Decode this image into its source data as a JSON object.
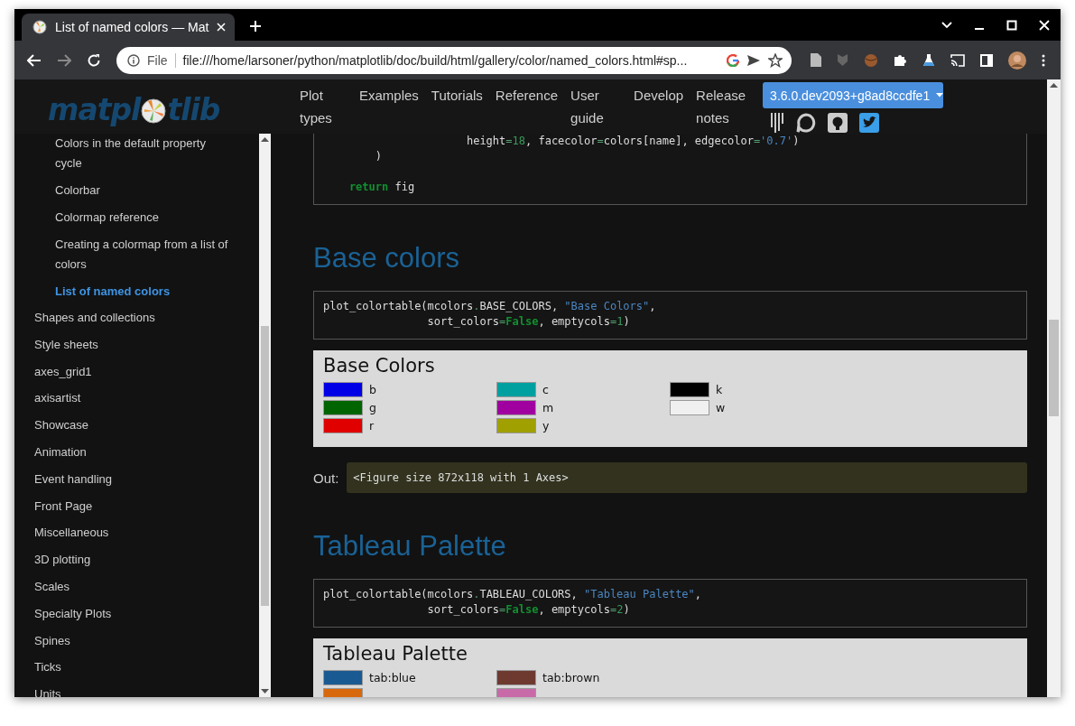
{
  "browser": {
    "tab": {
      "title": "List of named colors — Mat"
    },
    "address": {
      "scheme": "File",
      "url": "file:///home/larsoner/python/matplotlib/doc/build/html/gallery/color/named_colors.html#sp..."
    }
  },
  "header": {
    "logo": {
      "before": "matpl",
      "after": "tlib"
    },
    "nav": [
      {
        "label": "Plot types"
      },
      {
        "label": "Examples"
      },
      {
        "label": "Tutorials"
      },
      {
        "label": "Reference"
      },
      {
        "label": "User guide"
      },
      {
        "label": "Develop"
      },
      {
        "label": "Release notes"
      }
    ],
    "version_button": {
      "label": "3.6.0.dev2093+g8ad8ccdfe1"
    }
  },
  "sidebar": {
    "section_items": [
      {
        "label": "Colors in the default property cycle",
        "selected": false
      },
      {
        "label": "Colorbar",
        "selected": false
      },
      {
        "label": "Colormap reference",
        "selected": false
      },
      {
        "label": "Creating a colormap from a list of colors",
        "selected": false
      },
      {
        "label": "List of named colors",
        "selected": true
      }
    ],
    "items": [
      {
        "label": "Shapes and collections"
      },
      {
        "label": "Style sheets"
      },
      {
        "label": "axes_grid1"
      },
      {
        "label": "axisartist"
      },
      {
        "label": "Showcase"
      },
      {
        "label": "Animation"
      },
      {
        "label": "Event handling"
      },
      {
        "label": "Front Page"
      },
      {
        "label": "Miscellaneous"
      },
      {
        "label": "3D plotting"
      },
      {
        "label": "Scales"
      },
      {
        "label": "Specialty Plots"
      },
      {
        "label": "Spines"
      },
      {
        "label": "Ticks"
      },
      {
        "label": "Units"
      }
    ]
  },
  "content": [
    {
      "kind": "code",
      "cut_top": true,
      "lines": [
        {
          "kind": "code",
          "tokens": [
            {
              "kind": "text",
              "text": "                      height"
            },
            {
              "kind": "op",
              "text": "="
            },
            {
              "kind": "num",
              "text": "18"
            },
            {
              "kind": "text",
              "text": ", facecolor"
            },
            {
              "kind": "op",
              "text": "="
            },
            {
              "kind": "text",
              "text": "colors[name], edgecolor"
            },
            {
              "kind": "op",
              "text": "="
            },
            {
              "kind": "str",
              "text": "'0.7'"
            },
            {
              "kind": "text",
              "text": ")"
            }
          ]
        },
        {
          "kind": "code",
          "tokens": [
            {
              "kind": "text",
              "text": "        )"
            }
          ]
        },
        {
          "kind": "blank"
        },
        {
          "kind": "code",
          "tokens": [
            {
              "kind": "kw",
              "text": "    return"
            },
            {
              "kind": "text",
              "text": " fig"
            }
          ]
        }
      ]
    },
    {
      "kind": "heading",
      "text": "Base colors"
    },
    {
      "kind": "code",
      "cut_top": false,
      "lines": [
        {
          "kind": "code",
          "tokens": [
            {
              "kind": "text",
              "text": "plot_colortable(mcolors"
            },
            {
              "kind": "op",
              "text": "."
            },
            {
              "kind": "text",
              "text": "BASE_COLORS, "
            },
            {
              "kind": "str",
              "text": "\"Base Colors\""
            },
            {
              "kind": "text",
              "text": ","
            }
          ]
        },
        {
          "kind": "code",
          "tokens": [
            {
              "kind": "text",
              "text": "                sort_colors"
            },
            {
              "kind": "op",
              "text": "="
            },
            {
              "kind": "kw",
              "text": "False"
            },
            {
              "kind": "text",
              "text": ", emptycols"
            },
            {
              "kind": "op",
              "text": "="
            },
            {
              "kind": "num",
              "text": "1"
            },
            {
              "kind": "text",
              "text": ")"
            }
          ]
        }
      ]
    },
    {
      "kind": "figure",
      "title": "Base Colors",
      "columns": [
        [
          {
            "name": "b",
            "color": "#0000e6"
          },
          {
            "name": "g",
            "color": "#006400"
          },
          {
            "name": "r",
            "color": "#e00000"
          }
        ],
        [
          {
            "name": "c",
            "color": "#00a0a0"
          },
          {
            "name": "m",
            "color": "#a000a0"
          },
          {
            "name": "y",
            "color": "#a0a000"
          }
        ],
        [
          {
            "name": "k",
            "color": "#000000"
          },
          {
            "name": "w",
            "color": "#f0f0f0"
          }
        ]
      ]
    },
    {
      "kind": "output",
      "label": "Out:",
      "text": "<Figure size 872x118 with 1 Axes>"
    },
    {
      "kind": "heading",
      "text": "Tableau Palette"
    },
    {
      "kind": "code",
      "cut_top": false,
      "lines": [
        {
          "kind": "code",
          "tokens": [
            {
              "kind": "text",
              "text": "plot_colortable(mcolors"
            },
            {
              "kind": "op",
              "text": "."
            },
            {
              "kind": "text",
              "text": "TABLEAU_COLORS, "
            },
            {
              "kind": "str",
              "text": "\"Tableau Palette\""
            },
            {
              "kind": "text",
              "text": ","
            }
          ]
        },
        {
          "kind": "code",
          "tokens": [
            {
              "kind": "text",
              "text": "                sort_colors"
            },
            {
              "kind": "op",
              "text": "="
            },
            {
              "kind": "kw",
              "text": "False"
            },
            {
              "kind": "text",
              "text": ", emptycols"
            },
            {
              "kind": "op",
              "text": "="
            },
            {
              "kind": "num",
              "text": "2"
            },
            {
              "kind": "text",
              "text": ")"
            }
          ]
        }
      ]
    },
    {
      "kind": "figure",
      "title": "Tableau Palette",
      "columns": [
        [
          {
            "name": "tab:blue",
            "color": "#1a5a92"
          },
          {
            "color": "#d8680c"
          }
        ],
        [
          {
            "name": "tab:brown",
            "color": "#6e3a30"
          },
          {
            "color": "#c86aa8"
          }
        ]
      ]
    }
  ]
}
